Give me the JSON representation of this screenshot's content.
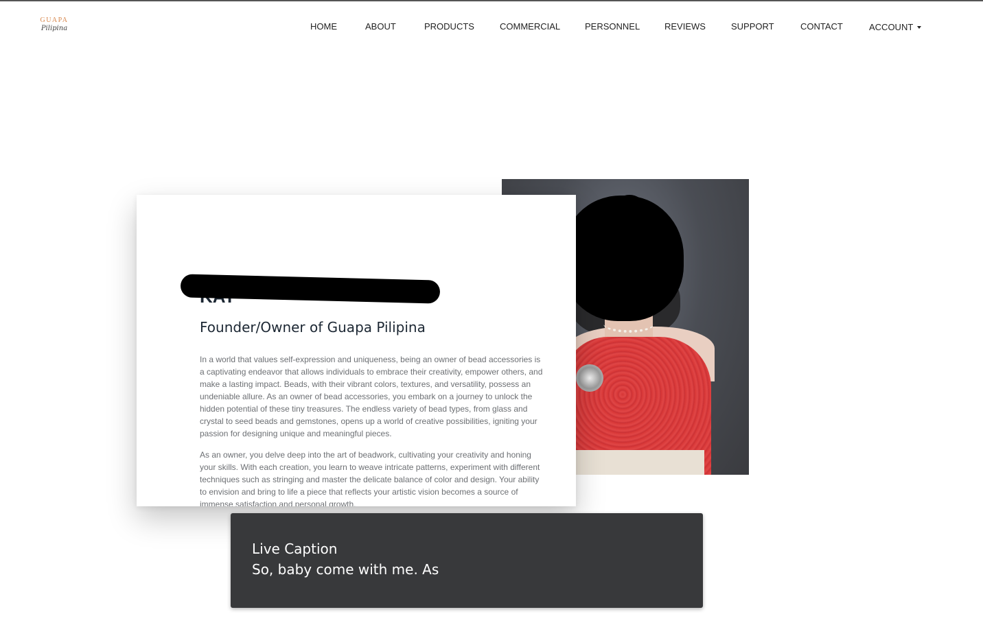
{
  "logo": {
    "line1": "GUAPA",
    "line2": "Pilipina"
  },
  "nav": {
    "items": [
      {
        "label": "HOME"
      },
      {
        "label": "ABOUT"
      },
      {
        "label": "PRODUCTS"
      },
      {
        "label": "COMMERCIAL"
      },
      {
        "label": "PERSONNEL"
      },
      {
        "label": "REVIEWS"
      },
      {
        "label": "SUPPORT"
      },
      {
        "label": "CONTACT"
      },
      {
        "label": "ACCOUNT"
      }
    ]
  },
  "profile": {
    "name_visible": "KAT",
    "role": "Founder/Owner of Guapa Pilipina",
    "paragraphs": [
      "In a world that values self-expression and uniqueness, being an owner of bead accessories is a captivating endeavor that allows individuals to embrace their creativity, empower others, and make a lasting impact. Beads, with their vibrant colors, textures, and versatility, possess an undeniable allure. As an owner of bead accessories, you embark on a journey to unlock the hidden potential of these tiny treasures. The endless variety of bead types, from glass and crystal to seed beads and gemstones, opens up a world of creative possibilities, igniting your passion for designing unique and meaningful pieces.",
      "As an owner, you delve deep into the art of beadwork, cultivating your creativity and honing your skills. With each creation, you learn to weave intricate patterns, experiment with different techniques such as stringing and master the delicate balance of color and design. Your ability to envision and bring to life a piece that reflects your artistic vision becomes a source of immense satisfaction and personal growth."
    ]
  },
  "live_caption": {
    "title": "Live Caption",
    "text": "So, baby come with me. As"
  },
  "colors": {
    "logo_accent": "#d7874d",
    "heading": "#1c2733",
    "body_text": "#6c6f73",
    "caption_bg": "#38393b",
    "dress_red": "#d63535"
  }
}
